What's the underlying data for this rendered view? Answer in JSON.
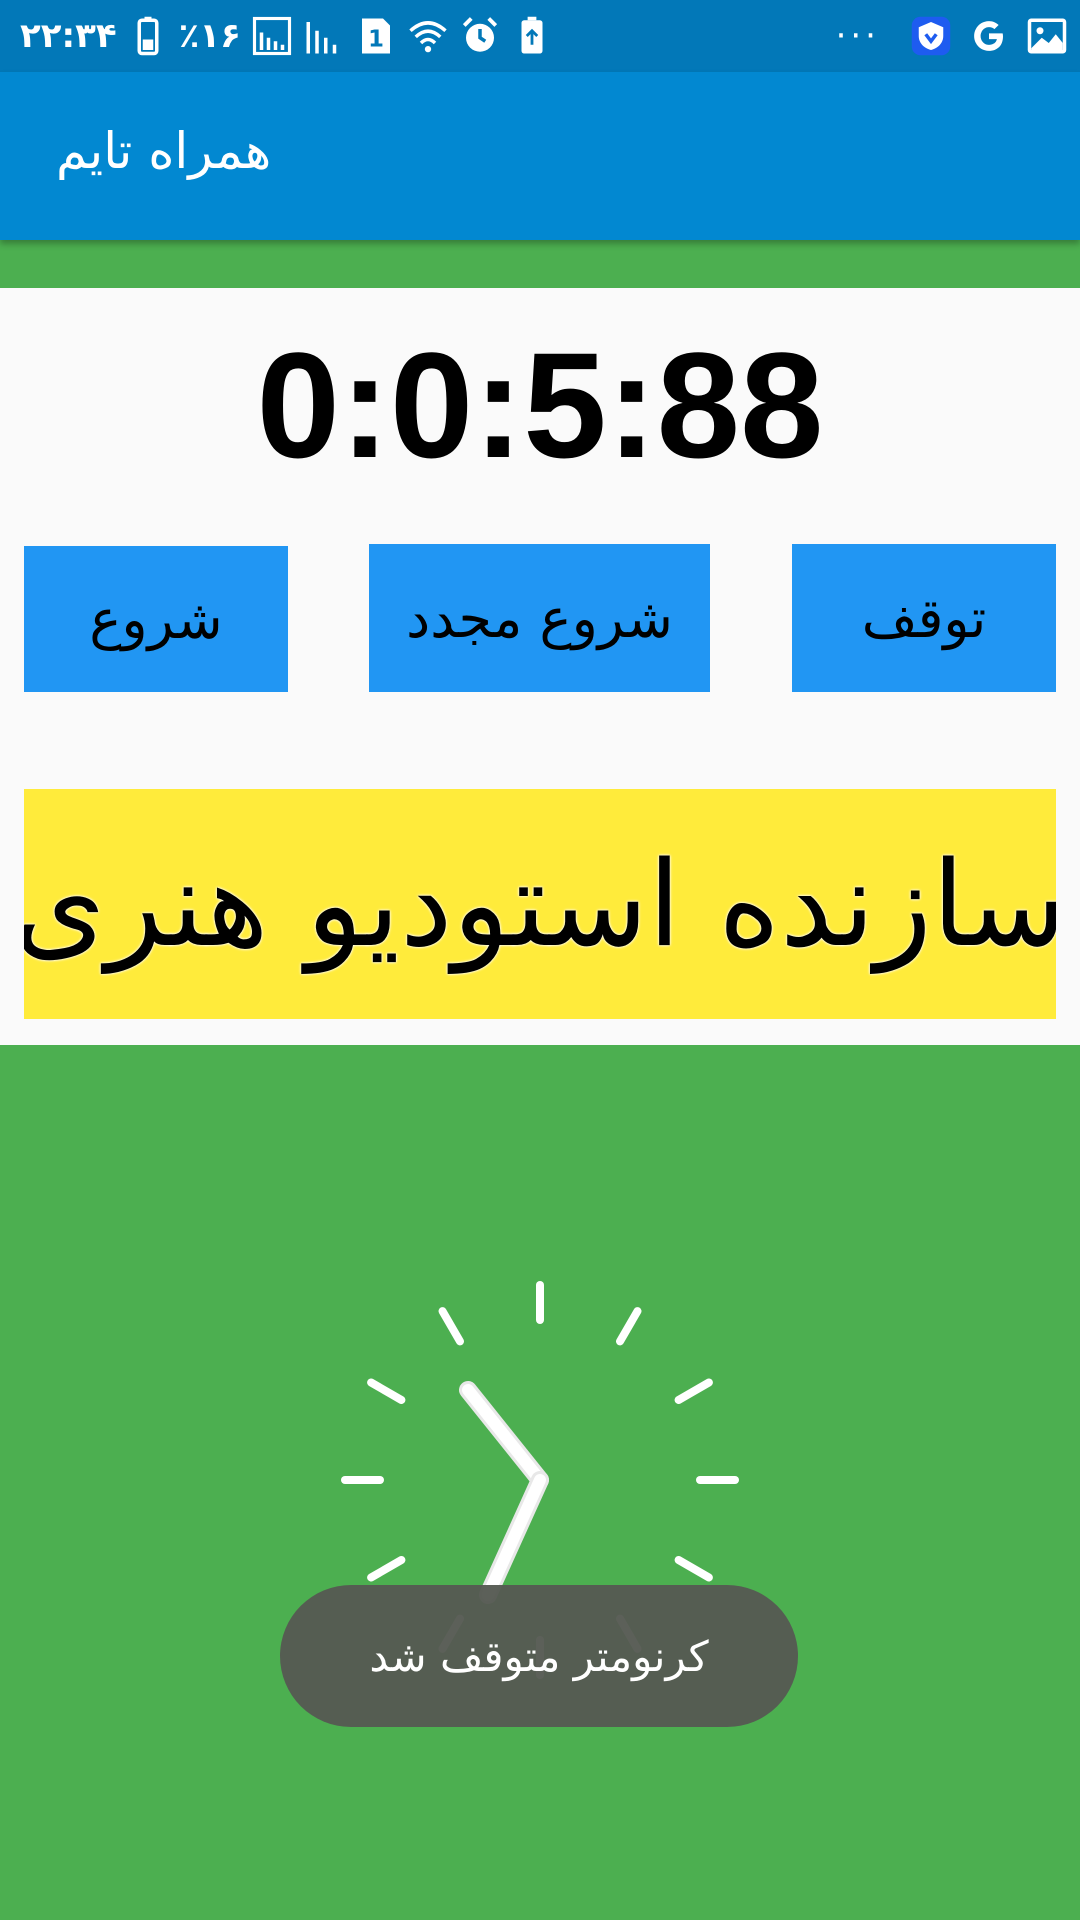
{
  "status_bar": {
    "time": "۲۲:۳۴",
    "battery_percent": "٪۱۶",
    "sim_label": "1",
    "icons": [
      "battery-icon",
      "signal-icon",
      "signal-icon-2",
      "sim-icon",
      "wifi-icon",
      "alarm-icon",
      "battery-saver-icon",
      "more-icon",
      "shield-app-icon",
      "google-icon",
      "image-icon"
    ]
  },
  "app_bar": {
    "title": "همراه تایم"
  },
  "stopwatch": {
    "display": "0:0:5:88"
  },
  "buttons": {
    "start": "شروع",
    "restart": "شروع مجدد",
    "stop": "توقف"
  },
  "banner": {
    "text": "سازنده استودیو هنری"
  },
  "toast": {
    "message": "کرنومتر متوقف شد"
  },
  "colors": {
    "status_bar": "#0278b8",
    "app_bar": "#0288d1",
    "background": "#4caf50",
    "panel": "#fafafa",
    "button": "#2196f3",
    "banner": "#ffeb3b",
    "toast": "#555a52"
  }
}
